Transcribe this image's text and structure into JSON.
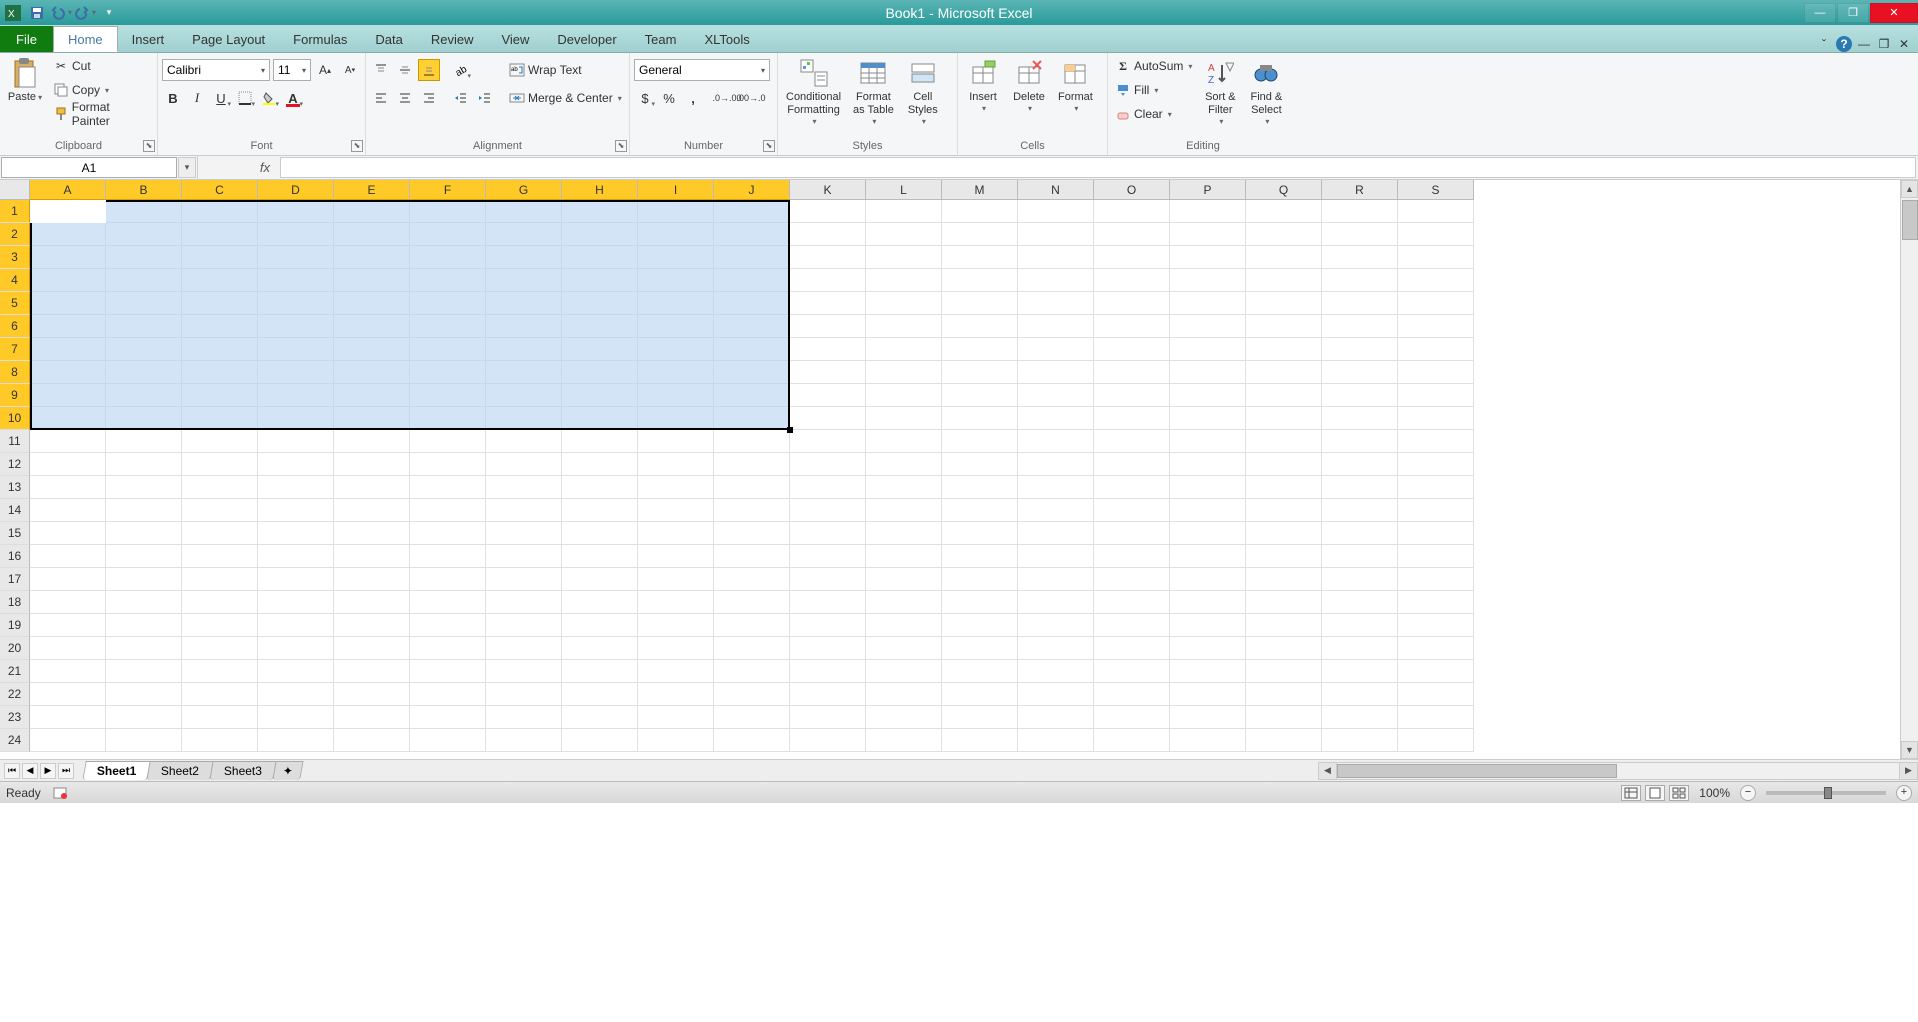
{
  "title": "Book1 - Microsoft Excel",
  "qat": {
    "save": "Save",
    "undo": "Undo",
    "redo": "Redo"
  },
  "tabs": {
    "file": "File",
    "list": [
      "Home",
      "Insert",
      "Page Layout",
      "Formulas",
      "Data",
      "Review",
      "View",
      "Developer",
      "Team",
      "XLTools"
    ],
    "active": "Home"
  },
  "ribbon": {
    "clipboard": {
      "label": "Clipboard",
      "paste": "Paste",
      "cut": "Cut",
      "copy": "Copy",
      "format_painter": "Format Painter"
    },
    "font": {
      "label": "Font",
      "name": "Calibri",
      "size": "11",
      "bold": "B",
      "italic": "I",
      "underline": "U"
    },
    "alignment": {
      "label": "Alignment",
      "wrap": "Wrap Text",
      "merge": "Merge & Center"
    },
    "number": {
      "label": "Number",
      "format": "General"
    },
    "styles": {
      "label": "Styles",
      "conditional": "Conditional\nFormatting",
      "as_table": "Format\nas Table",
      "cell_styles": "Cell\nStyles"
    },
    "cells": {
      "label": "Cells",
      "insert": "Insert",
      "delete": "Delete",
      "format": "Format"
    },
    "editing": {
      "label": "Editing",
      "autosum": "AutoSum",
      "fill": "Fill",
      "clear": "Clear",
      "sort": "Sort &\nFilter",
      "find": "Find &\nSelect"
    }
  },
  "name_box": "A1",
  "fx": "fx",
  "columns": [
    "A",
    "B",
    "C",
    "D",
    "E",
    "F",
    "G",
    "H",
    "I",
    "J",
    "K",
    "L",
    "M",
    "N",
    "O",
    "P",
    "Q",
    "R",
    "S"
  ],
  "selected_cols": [
    "A",
    "B",
    "C",
    "D",
    "E",
    "F",
    "G",
    "H",
    "I",
    "J"
  ],
  "rows": [
    1,
    2,
    3,
    4,
    5,
    6,
    7,
    8,
    9,
    10,
    11,
    12,
    13,
    14,
    15,
    16,
    17,
    18,
    19,
    20,
    21,
    22,
    23,
    24
  ],
  "selected_rows": [
    1,
    2,
    3,
    4,
    5,
    6,
    7,
    8,
    9,
    10
  ],
  "selection": {
    "range": "A1:J10",
    "active": "A1"
  },
  "sheets": {
    "list": [
      "Sheet1",
      "Sheet2",
      "Sheet3"
    ],
    "active": "Sheet1"
  },
  "status": {
    "ready": "Ready",
    "zoom": "100%"
  }
}
